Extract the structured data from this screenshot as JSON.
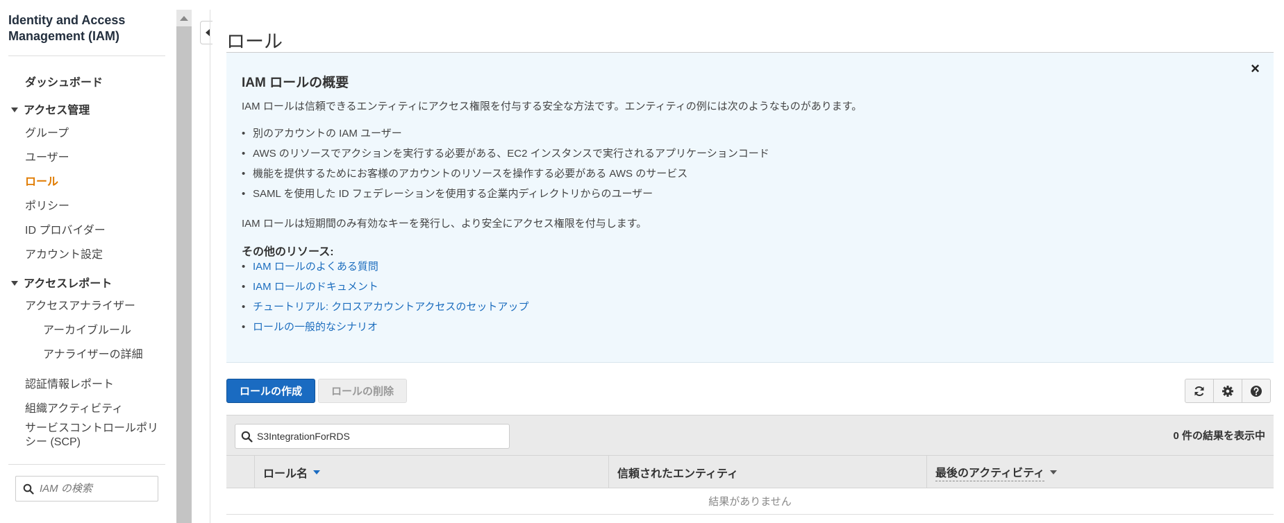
{
  "sidebar": {
    "title": "Identity and Access Management (IAM)",
    "dashboard": "ダッシュボード",
    "access_management": {
      "label": "アクセス管理",
      "items": [
        "グループ",
        "ユーザー",
        "ロール",
        "ポリシー",
        "ID プロバイダー",
        "アカウント設定"
      ],
      "active": "ロール"
    },
    "access_reports": {
      "label": "アクセスレポート",
      "analyzer": "アクセスアナライザー",
      "archive_rules": "アーカイブルール",
      "analyzer_details": "アナライザーの詳細",
      "credential_report": "認証情報レポート",
      "org_activity": "組織アクティビティ",
      "scp": "サービスコントロールポリシー (SCP)"
    },
    "search_placeholder": "IAM の検索"
  },
  "main": {
    "page_title": "ロール",
    "info": {
      "heading": "IAM ロールの概要",
      "intro": "IAM ロールは信頼できるエンティティにアクセス権限を付与する安全な方法です。エンティティの例には次のようなものがあります。",
      "examples": [
        "別のアカウントの IAM ユーザー",
        "AWS のリソースでアクションを実行する必要がある、EC2 インスタンスで実行されるアプリケーションコード",
        "機能を提供するためにお客様のアカウントのリソースを操作する必要がある AWS のサービス",
        "SAML を使用した ID フェデレーションを使用する企業内ディレクトリからのユーザー"
      ],
      "note": "IAM ロールは短期間のみ有効なキーを発行し、より安全にアクセス権限を付与します。",
      "resources_heading": "その他のリソース:",
      "links": [
        "IAM ロールのよくある質問",
        "IAM ロールのドキュメント",
        "チュートリアル: クロスアカウントアクセスのセットアップ",
        "ロールの一般的なシナリオ"
      ],
      "close_symbol": "×"
    },
    "toolbar": {
      "create_label": "ロールの作成",
      "delete_label": "ロールの削除"
    },
    "filter": {
      "value": "S3IntegrationForRDS",
      "result_count": "0 件の結果を表示中"
    },
    "table": {
      "columns": [
        "ロール名",
        "信頼されたエンティティ",
        "最後のアクティビティ"
      ],
      "empty_message": "結果がありません"
    }
  },
  "colors": {
    "accent": "#1a6bc1",
    "active_nav": "#e07b00",
    "info_bg": "#f0f8fd",
    "link": "#1c6dbe"
  }
}
